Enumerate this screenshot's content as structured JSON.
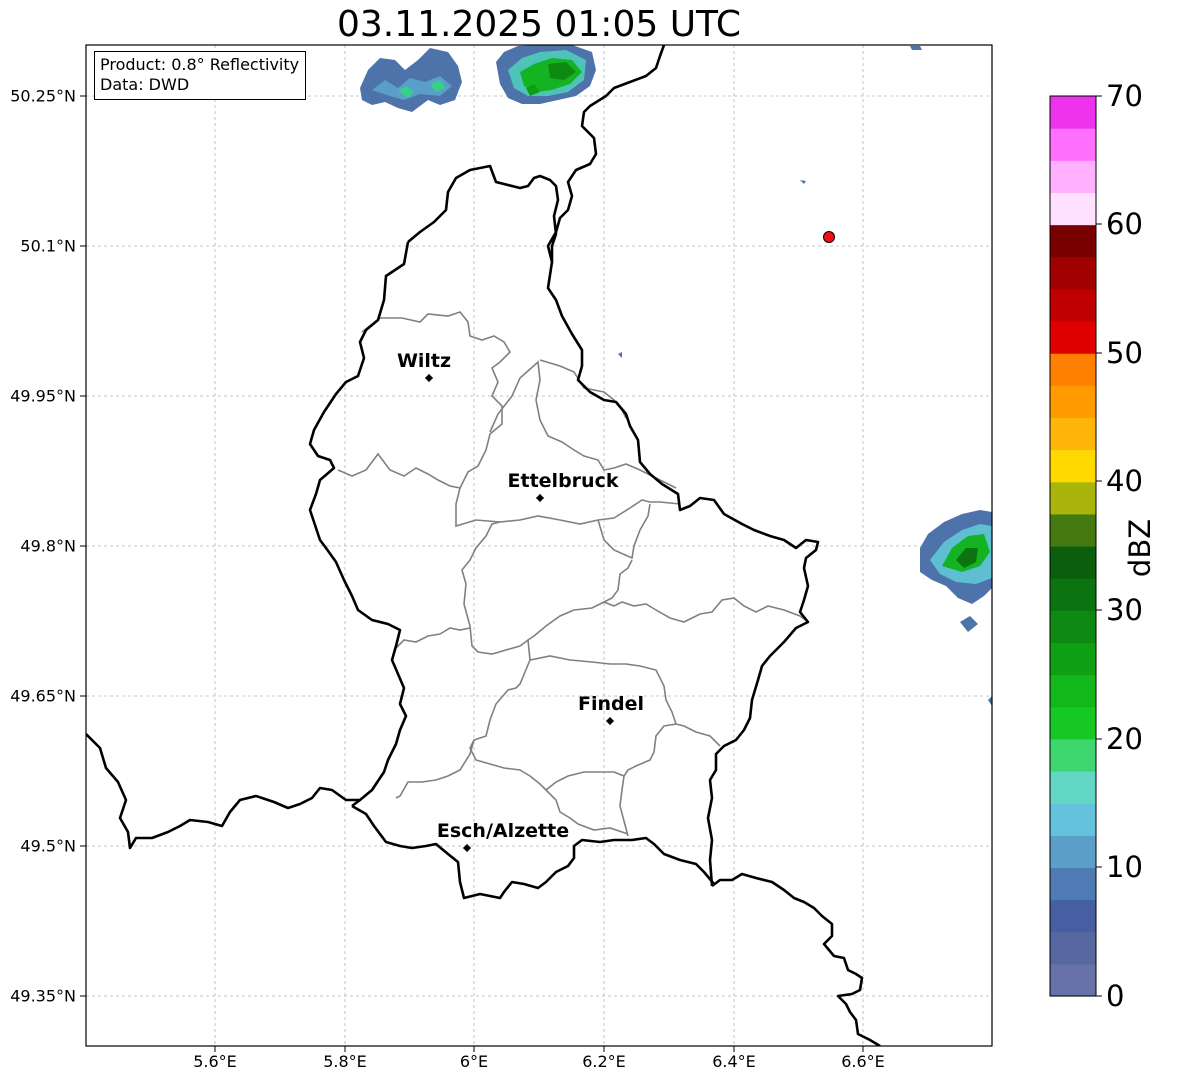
{
  "title": "03.11.2025 01:05 UTC",
  "info_box": {
    "product": "Product: 0.8° Reflectivity",
    "data": "Data: DWD"
  },
  "axes": {
    "lat_labels": [
      "50.25°N",
      "50.1°N",
      "49.95°N",
      "49.8°N",
      "49.65°N",
      "49.5°N",
      "49.35°N"
    ],
    "lon_labels": [
      "5.6°E",
      "5.8°E",
      "6°E",
      "6.2°E",
      "6.4°E",
      "6.6°E"
    ]
  },
  "cities": [
    {
      "name": "Wiltz"
    },
    {
      "name": "Ettelbruck"
    },
    {
      "name": "Findel"
    },
    {
      "name": "Esch/Alzette"
    }
  ],
  "colorbar": {
    "label": "dBZ",
    "ticks": [
      "0",
      "10",
      "20",
      "30",
      "40",
      "50",
      "60",
      "70"
    ],
    "colors": [
      "#6672a8",
      "#56689f",
      "#465fa2",
      "#4e7bb3",
      "#5b9fc9",
      "#65c2dc",
      "#62d7c6",
      "#3ed66f",
      "#16c824",
      "#12b81a",
      "#10a014",
      "#0e8a12",
      "#0b7410",
      "#0a5e0c",
      "#457a10",
      "#aab50b",
      "#ffd900",
      "#ffb60a",
      "#ff9a00",
      "#ff7f00",
      "#e00000",
      "#c00000",
      "#a00000",
      "#7a0000",
      "#ffe1ff",
      "#ffb1ff",
      "#ff70ff",
      "#ee33ee"
    ]
  },
  "radar_marker_color": "#ee1111"
}
